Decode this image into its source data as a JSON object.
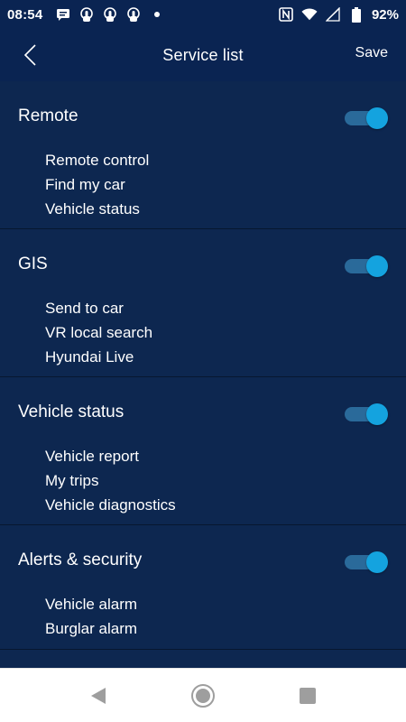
{
  "status_bar": {
    "time": "08:54",
    "battery_percent": "92%",
    "icons": [
      "message-icon",
      "hand-icon",
      "hand-icon",
      "hand-icon",
      "dot-icon",
      "nfc-icon",
      "wifi-icon",
      "signal-icon",
      "battery-icon"
    ]
  },
  "header": {
    "title": "Service list",
    "save_label": "Save",
    "back_icon": "chevron-left-icon"
  },
  "colors": {
    "header_bg": "#0a2452",
    "content_bg": "#0d2750",
    "toggle_knob": "#14a3df",
    "toggle_track": "#2a6a9a"
  },
  "sections": [
    {
      "title": "Remote",
      "enabled": true,
      "items": [
        "Remote control",
        "Find my car",
        "Vehicle status"
      ]
    },
    {
      "title": "GIS",
      "enabled": true,
      "items": [
        "Send to car",
        "VR local search",
        "Hyundai Live"
      ]
    },
    {
      "title": "Vehicle status",
      "enabled": true,
      "items": [
        "Vehicle report",
        "My trips",
        "Vehicle diagnostics"
      ]
    },
    {
      "title": "Alerts & security",
      "enabled": true,
      "items": [
        "Vehicle alarm",
        "Burglar alarm"
      ]
    }
  ],
  "nav_bar": {
    "buttons": [
      "back-triangle-icon",
      "home-circle-icon",
      "recents-square-icon"
    ]
  }
}
